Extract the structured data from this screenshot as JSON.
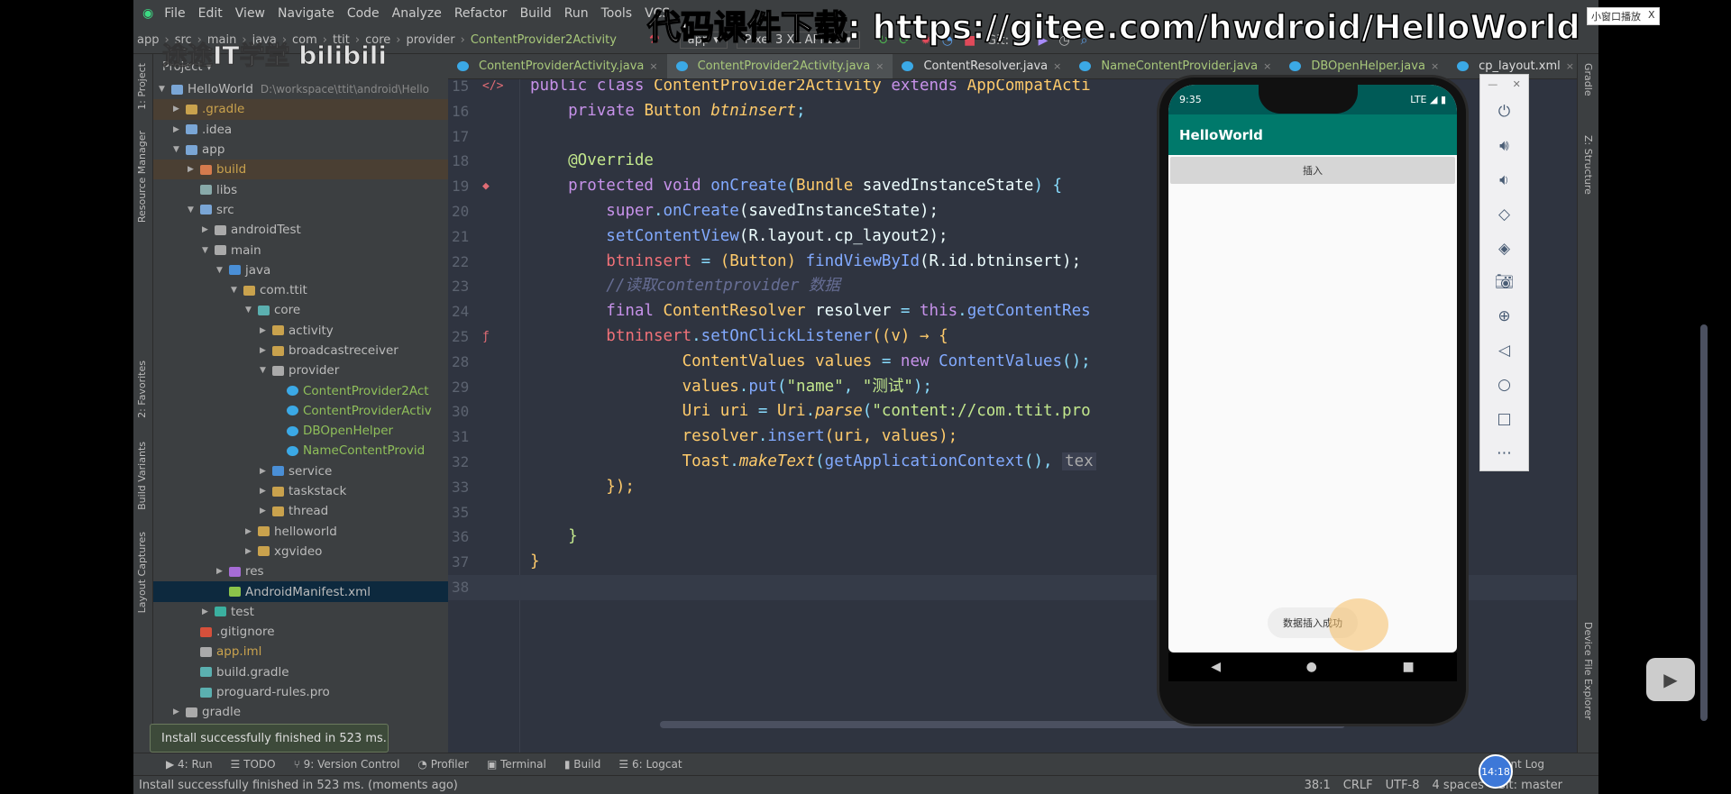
{
  "menu": [
    "File",
    "Edit",
    "View",
    "Navigate",
    "Code",
    "Analyze",
    "Refactor",
    "Build",
    "Run",
    "Tools",
    "VCS"
  ],
  "watermark": "代码课件下载: https://gitee.com/hwdroid/HelloWorld",
  "channel_logo": "途途IT学堂 bilibili",
  "breadcrumb": [
    "app",
    "src",
    "main",
    "java",
    "com",
    "ttit",
    "core",
    "provider",
    "ContentProvider2Activity"
  ],
  "run_config": "app ▾",
  "device": "Pixel 3 XL API 29 ▾",
  "git_label": "Git:",
  "project_header": "Project ▾",
  "left_tabs": [
    "1: Project",
    "Resource Manager",
    "2: Favorites",
    "Build Variants",
    "Layout Captures"
  ],
  "right_tabs": [
    "Gradle",
    "Z: Structure",
    "Device File Explorer"
  ],
  "tree": [
    {
      "label": "HelloWorld",
      "extra": "D:\\workspace\\ttit\\android\\Hello",
      "level": 0,
      "arrow": "▼",
      "color": "#7aa6d6"
    },
    {
      "label": ".gradle",
      "level": 1,
      "arrow": "▶",
      "color": "#c9a24d",
      "hl": true
    },
    {
      "label": ".idea",
      "level": 1,
      "arrow": "▶",
      "color": "#7aa6d6"
    },
    {
      "label": "app",
      "level": 1,
      "arrow": "▼",
      "color": "#7aa6d6"
    },
    {
      "label": "build",
      "level": 2,
      "arrow": "▶",
      "color": "#d67b4d",
      "hl": true
    },
    {
      "label": "libs",
      "level": 2,
      "arrow": "",
      "color": "#8aa"
    },
    {
      "label": "src",
      "level": 2,
      "arrow": "▼",
      "color": "#7aa6d6"
    },
    {
      "label": "androidTest",
      "level": 3,
      "arrow": "▶",
      "color": "#aaa"
    },
    {
      "label": "main",
      "level": 3,
      "arrow": "▼",
      "color": "#aaa"
    },
    {
      "label": "java",
      "level": 4,
      "arrow": "▼",
      "color": "#4a8fd6"
    },
    {
      "label": "com.ttit",
      "level": 5,
      "arrow": "▼",
      "color": "#c9a24d"
    },
    {
      "label": "core",
      "level": 6,
      "arrow": "▼",
      "color": "#5bb0b0"
    },
    {
      "label": "activity",
      "level": 7,
      "arrow": "▶",
      "color": "#c9a24d"
    },
    {
      "label": "broadcastreceiver",
      "level": 7,
      "arrow": "▶",
      "color": "#c9a24d"
    },
    {
      "label": "provider",
      "level": 7,
      "arrow": "▼",
      "color": "#aaa"
    },
    {
      "label": "ContentProvider2Act",
      "level": 8,
      "arrow": "",
      "color": "#3ba9e6",
      "green": true
    },
    {
      "label": "ContentProviderActiv",
      "level": 8,
      "arrow": "",
      "color": "#3ba9e6",
      "green": true
    },
    {
      "label": "DBOpenHelper",
      "level": 8,
      "arrow": "",
      "color": "#3ba9e6",
      "green": true
    },
    {
      "label": "NameContentProvid",
      "level": 8,
      "arrow": "",
      "color": "#3ba9e6",
      "green": true
    },
    {
      "label": "service",
      "level": 7,
      "arrow": "▶",
      "color": "#4a8fd6"
    },
    {
      "label": "taskstack",
      "level": 7,
      "arrow": "▶",
      "color": "#c9a24d"
    },
    {
      "label": "thread",
      "level": 7,
      "arrow": "▶",
      "color": "#c9a24d"
    },
    {
      "label": "helloworld",
      "level": 6,
      "arrow": "▶",
      "color": "#c9a24d"
    },
    {
      "label": "xgvideo",
      "level": 6,
      "arrow": "▶",
      "color": "#c9a24d"
    },
    {
      "label": "res",
      "level": 4,
      "arrow": "▶",
      "color": "#a66cd6"
    },
    {
      "label": "AndroidManifest.xml",
      "level": 4,
      "arrow": "",
      "color": "#8bc34a",
      "sel": true
    },
    {
      "label": "test",
      "level": 3,
      "arrow": "▶",
      "color": "#3bb0a0"
    },
    {
      "label": ".gitignore",
      "level": 2,
      "arrow": "",
      "color": "#d6503b"
    },
    {
      "label": "app.iml",
      "level": 2,
      "arrow": "",
      "color": "#aaa",
      "amber": true
    },
    {
      "label": "build.gradle",
      "level": 2,
      "arrow": "",
      "color": "#5bb0b0"
    },
    {
      "label": "proguard-rules.pro",
      "level": 2,
      "arrow": "",
      "color": "#5bb0b0"
    },
    {
      "label": "gradle",
      "level": 1,
      "arrow": "▶",
      "color": "#aaa"
    }
  ],
  "tabs": [
    {
      "label": "ContentProviderActivity.java",
      "color": "#a8c87a"
    },
    {
      "label": "ContentProvider2Activity.java",
      "color": "#a8c87a",
      "active": true
    },
    {
      "label": "ContentResolver.java",
      "color": "#ddd"
    },
    {
      "label": "NameContentProvider.java",
      "color": "#a8c87a"
    },
    {
      "label": "DBOpenHelper.java",
      "color": "#a8c87a"
    },
    {
      "label": "cp_layout.xml",
      "color": "#ddd"
    }
  ],
  "code": [
    {
      "n": "15",
      "g": "</>",
      "t": [
        [
          "public class ",
          "kw"
        ],
        [
          "ContentProvider2Activity ",
          "ty"
        ],
        [
          "extends ",
          "kw"
        ],
        [
          "AppCompatActi",
          "ty"
        ]
      ]
    },
    {
      "n": "16",
      "t": [
        [
          "    private ",
          "kw"
        ],
        [
          "Button ",
          "ty"
        ],
        [
          "btninsert",
          "it"
        ],
        [
          ";",
          "pu"
        ]
      ]
    },
    {
      "n": "17",
      "t": []
    },
    {
      "n": "18",
      "t": [
        [
          "    @Override",
          "an"
        ]
      ]
    },
    {
      "n": "19",
      "g": "◆",
      "t": [
        [
          "    protected void ",
          "kw"
        ],
        [
          "onCreate",
          "fn"
        ],
        [
          "(",
          "pu"
        ],
        [
          "Bundle ",
          "ty"
        ],
        [
          "savedInstanceState",
          "pl"
        ],
        [
          ") {",
          "pu"
        ]
      ]
    },
    {
      "n": "20",
      "t": [
        [
          "        super",
          "kw"
        ],
        [
          ".",
          "pu"
        ],
        [
          "onCreate",
          "fn"
        ],
        [
          "(savedInstanceState);",
          "pl"
        ]
      ]
    },
    {
      "n": "21",
      "t": [
        [
          "        setContentView",
          "fn"
        ],
        [
          "(R.layout.cp_layout2);",
          "pl"
        ]
      ]
    },
    {
      "n": "22",
      "t": [
        [
          "        btninsert ",
          "va"
        ],
        [
          "= ",
          "pu"
        ],
        [
          "(Button) ",
          "ty"
        ],
        [
          "findViewById",
          "fn"
        ],
        [
          "(R.id.btninsert);",
          "pl"
        ]
      ]
    },
    {
      "n": "23",
      "t": [
        [
          "        //读取contentprovider 数据",
          "cm"
        ]
      ]
    },
    {
      "n": "24",
      "t": [
        [
          "        final ",
          "kw"
        ],
        [
          "ContentResolver ",
          "ty"
        ],
        [
          "resolver ",
          "pl"
        ],
        [
          "= ",
          "pu"
        ],
        [
          "this",
          "kw"
        ],
        [
          ".",
          "pu"
        ],
        [
          "getContentRes",
          "fn"
        ]
      ]
    },
    {
      "n": "25",
      "g": "ƒ",
      "t": [
        [
          "        btninsert",
          "va"
        ],
        [
          ".",
          "pu"
        ],
        [
          "setOnClickListener",
          "fn"
        ],
        [
          "((v) → {",
          "ty"
        ]
      ]
    },
    {
      "n": "28",
      "t": [
        [
          "                ContentValues ",
          "ty"
        ],
        [
          "values ",
          "ty"
        ],
        [
          "= ",
          "pu"
        ],
        [
          "new ",
          "kw"
        ],
        [
          "ContentValues",
          "fn"
        ],
        [
          "();",
          "pu"
        ]
      ]
    },
    {
      "n": "29",
      "t": [
        [
          "                values",
          "ty"
        ],
        [
          ".",
          "pu"
        ],
        [
          "put",
          "fn"
        ],
        [
          "(",
          "pu"
        ],
        [
          "\"name\"",
          "st"
        ],
        [
          ", ",
          "pu"
        ],
        [
          "\"测试\"",
          "st"
        ],
        [
          ");",
          "pu"
        ]
      ]
    },
    {
      "n": "30",
      "t": [
        [
          "                Uri ",
          "ty"
        ],
        [
          "uri ",
          "ty"
        ],
        [
          "= ",
          "pu"
        ],
        [
          "Uri",
          "ty"
        ],
        [
          ".",
          "pu"
        ],
        [
          "parse",
          "it"
        ],
        [
          "(",
          "pu"
        ],
        [
          "\"content://com.ttit.pro",
          "st"
        ]
      ]
    },
    {
      "n": "31",
      "t": [
        [
          "                resolver",
          "ty"
        ],
        [
          ".",
          "pu"
        ],
        [
          "insert",
          "fn"
        ],
        [
          "(uri, values);",
          "ty"
        ]
      ]
    },
    {
      "n": "32",
      "t": [
        [
          "                Toast",
          "ty"
        ],
        [
          ".",
          "pu"
        ],
        [
          "makeText",
          "it"
        ],
        [
          "(",
          "pu"
        ],
        [
          "getApplicationContext",
          "fn"
        ],
        [
          "(), ",
          "pu"
        ],
        [
          "tex",
          "hint"
        ]
      ]
    },
    {
      "n": "33",
      "t": [
        [
          "        });",
          "ty"
        ]
      ]
    },
    {
      "n": "35",
      "t": []
    },
    {
      "n": "36",
      "t": [
        [
          "    }",
          "an"
        ]
      ]
    },
    {
      "n": "37",
      "t": [
        [
          "}",
          "ty"
        ]
      ]
    },
    {
      "n": "38",
      "t": [],
      "cur": true
    }
  ],
  "overflow_text": "show",
  "phone": {
    "time": "9:35",
    "signal": "LTE ◢ ▮",
    "app_title": "HelloWorld",
    "button": "插入",
    "toast": "数据插入成功"
  },
  "emulator_controls": [
    "power-icon",
    "volume-up-icon",
    "volume-down-icon",
    "rotate-left-icon",
    "rotate-right-icon",
    "camera-icon",
    "zoom-icon",
    "back-icon",
    "home-icon",
    "overview-icon",
    "more-icon"
  ],
  "bottom_tools": [
    "▶ 4: Run",
    "☰ TODO",
    "⑂ 9: Version Control",
    "◔ Profiler",
    "▣ Terminal",
    "▮ Build",
    "☰ 6: Logcat"
  ],
  "event_log": "Event Log",
  "tooltip": "Install successfully finished in 523 ms.",
  "status_message": "Install successfully finished in 523 ms. (moments ago)",
  "status_right": [
    "38:1",
    "CRLF",
    "UTF-8",
    "4 spaces",
    "Git: master"
  ],
  "clock": "14:18",
  "mini_window": "小窗口播放",
  "mini_close": "X"
}
